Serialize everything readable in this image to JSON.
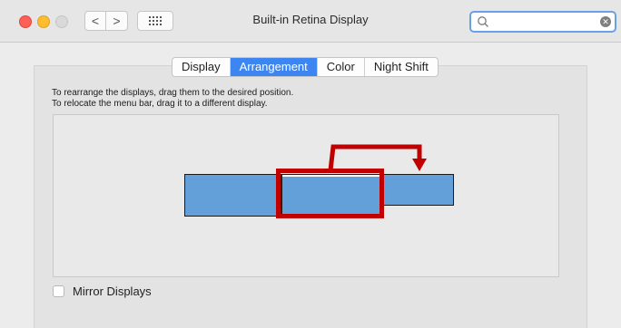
{
  "window": {
    "title": "Built-in Retina Display"
  },
  "toolbar": {
    "back_label": "<",
    "forward_label": ">"
  },
  "search": {
    "placeholder": "",
    "value": ""
  },
  "tabs": [
    {
      "label": "Display",
      "active": false
    },
    {
      "label": "Arrangement",
      "active": true
    },
    {
      "label": "Color",
      "active": false
    },
    {
      "label": "Night Shift",
      "active": false
    }
  ],
  "instructions": {
    "line1": "To rearrange the displays, drag them to the desired position.",
    "line2": "To relocate the menu bar, drag it to a different display."
  },
  "mirror": {
    "label": "Mirror Displays",
    "checked": false
  },
  "colors": {
    "accent": "#3d86f2",
    "display_fill": "#639fd8",
    "annotation_red": "#c00000"
  }
}
